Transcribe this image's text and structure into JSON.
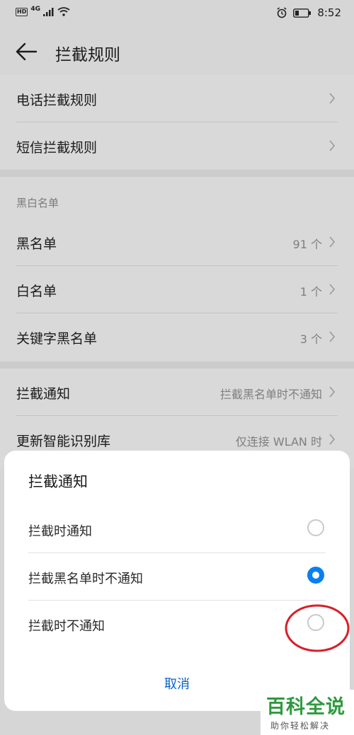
{
  "status_bar": {
    "badge": "HD",
    "network": "4G",
    "time": "8:52"
  },
  "header": {
    "title": "拦截规则"
  },
  "group1": [
    {
      "label": "电话拦截规则"
    },
    {
      "label": "短信拦截规则"
    }
  ],
  "blackwhite": {
    "heading": "黑白名单",
    "items": [
      {
        "label": "黑名单",
        "value": "91 个"
      },
      {
        "label": "白名单",
        "value": "1 个"
      },
      {
        "label": "关键字黑名单",
        "value": "3 个"
      }
    ]
  },
  "group3": [
    {
      "label": "拦截通知",
      "value": "拦截黑名单时不通知"
    },
    {
      "label": "更新智能识别库",
      "value": "仅连接 WLAN 时"
    }
  ],
  "dialog": {
    "title": "拦截通知",
    "options": [
      {
        "label": "拦截时通知",
        "selected": false
      },
      {
        "label": "拦截黑名单时不通知",
        "selected": true
      },
      {
        "label": "拦截时不通知",
        "selected": false
      }
    ],
    "cancel": "取消"
  },
  "watermark": {
    "main": "百科全说",
    "sub": "助你轻松解决"
  },
  "colors": {
    "accent": "#0a7ff0",
    "annotation": "#d8202a",
    "watermark": "#2e9a3e"
  }
}
